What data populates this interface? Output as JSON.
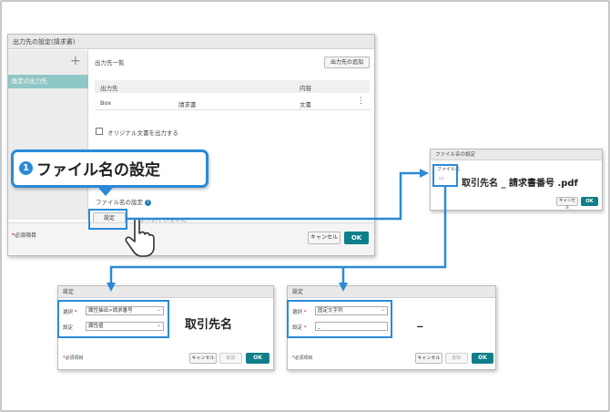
{
  "main_dialog": {
    "title": "出力先の設定(請求書)",
    "sidebar_add": "+",
    "sidebar_item": "既定の出力先",
    "list_title": "出力先一覧",
    "add_button": "出力先の追加",
    "columns": [
      "出力先",
      "内容"
    ],
    "row": {
      "destination": "Box",
      "doc_type": "請求書",
      "content": "文書",
      "menu": "⋮"
    },
    "checkbox_label": "オリジナル文書を出力する",
    "filename_label": "ファイル名の設定",
    "info_icon": "i",
    "settings_button": "設定",
    "hint_text": "設定されていません",
    "required_note": "必須項目",
    "required_mark": "*",
    "cancel": "キャンセル",
    "ok": "OK"
  },
  "callout": {
    "number": "1",
    "text": "ファイル名の設定"
  },
  "filename_dialog": {
    "title": "ファイル名の設定",
    "field_label": "ファイル名",
    "preview": "取引先名 _ 請求書番号 .pdf",
    "cancel": "キャンセル",
    "ok": "OK"
  },
  "settings_left": {
    "title": "設定",
    "select_label": "選択",
    "select_value": "属性抽出>請求番号",
    "setting_label": "設定",
    "setting_value": "属性値",
    "result": "取引先名",
    "required_note": "必須項目",
    "cancel": "キャンセル",
    "delete": "削除",
    "ok": "OK"
  },
  "settings_right": {
    "title": "設定",
    "select_label": "選択",
    "select_value": "固定文字列",
    "setting_label": "設定",
    "setting_value": "_",
    "result": "_",
    "required_note": "必須項目",
    "cancel": "キャンセル",
    "delete": "削除",
    "ok": "OK"
  },
  "colors": {
    "accent": "#2b8ad6",
    "ok_button": "#0f7f8a",
    "sidebar_selected": "#8fc6c6"
  }
}
